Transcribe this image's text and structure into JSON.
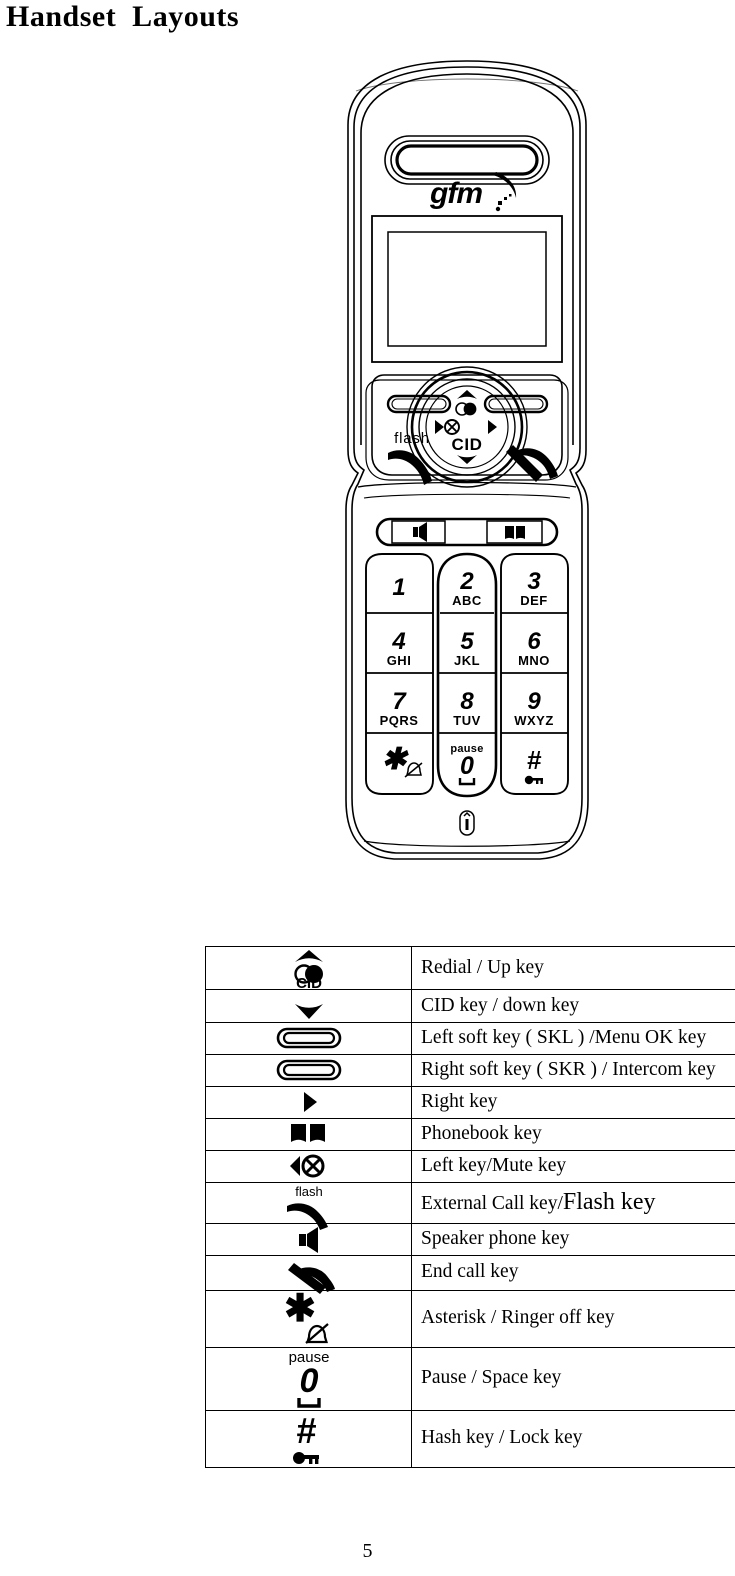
{
  "document": {
    "title": "Handset  Layouts",
    "page_number": "5"
  },
  "handset": {
    "brand_logo": "gfm",
    "labels": {
      "flash": "flash",
      "cid": "CID",
      "pause": "pause"
    },
    "keypad": [
      {
        "digit": "1",
        "letters": ""
      },
      {
        "digit": "2",
        "letters": "ABC"
      },
      {
        "digit": "3",
        "letters": "DEF"
      },
      {
        "digit": "4",
        "letters": "GHI"
      },
      {
        "digit": "5",
        "letters": "JKL"
      },
      {
        "digit": "6",
        "letters": "MNO"
      },
      {
        "digit": "7",
        "letters": "PQRS"
      },
      {
        "digit": "8",
        "letters": "TUV"
      },
      {
        "digit": "9",
        "letters": "WXYZ"
      },
      {
        "digit": "*",
        "letters": ""
      },
      {
        "digit": "0",
        "letters": ""
      },
      {
        "digit": "#",
        "letters": ""
      }
    ],
    "icons": [
      "speaker-icon",
      "phonebook-icon",
      "earpiece-grille",
      "lcd-display",
      "left-soft-key",
      "right-soft-key",
      "navigation-ring",
      "up-arrow-icon",
      "down-arrow-icon",
      "left-arrow-icon",
      "right-arrow-icon",
      "redial-icon",
      "mute-icon",
      "call-key-icon",
      "end-call-key-icon",
      "microphone-icon",
      "ringer-off-icon",
      "space-icon",
      "lock-icon"
    ]
  },
  "key_legend": {
    "rows": [
      {
        "icon": "redial-up-key-icon",
        "description": "Redial / Up key"
      },
      {
        "icon": "cid-down-key-icon",
        "description": "CID key / down key"
      },
      {
        "icon": "left-soft-key-icon",
        "description": "Left soft key ( SKL ) /Menu OK key"
      },
      {
        "icon": "right-soft-key-icon",
        "description": "Right soft key ( SKR ) / Intercom key"
      },
      {
        "icon": "right-key-icon",
        "description": "Right key"
      },
      {
        "icon": "phonebook-key-icon",
        "description": "Phonebook key"
      },
      {
        "icon": "left-mute-key-icon",
        "description": "Left key/Mute key"
      },
      {
        "icon": "external-call-flash-key-icon",
        "description": "External Call key/",
        "description_emphasis": "Flash key"
      },
      {
        "icon": "speaker-phone-key-icon",
        "description": "Speaker phone key"
      },
      {
        "icon": "end-call-key-icon",
        "description": "End call key"
      },
      {
        "icon": "asterisk-ringer-off-key-icon",
        "description": "Asterisk / Ringer off key"
      },
      {
        "icon": "pause-space-key-icon",
        "description": "Pause / Space key"
      },
      {
        "icon": "hash-lock-key-icon",
        "description": "Hash key / Lock key"
      }
    ]
  },
  "colors": {
    "ink": "#000000",
    "paper": "#ffffff"
  }
}
